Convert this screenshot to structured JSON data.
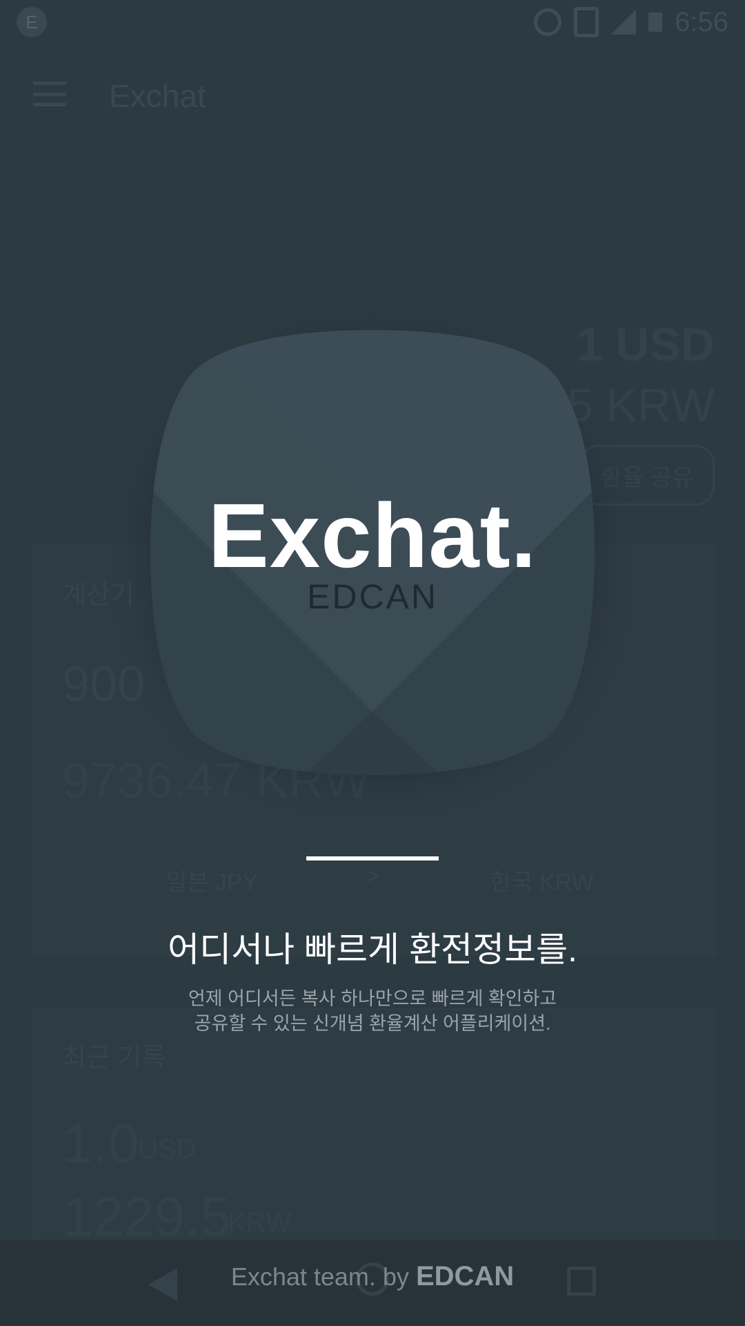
{
  "status_bar": {
    "time": "6:56",
    "left_icon": "E"
  },
  "background_app": {
    "title": "Exchat",
    "rate_from": "1 USD",
    "rate_to": "5 KRW",
    "share_button": "환율 공유",
    "calculator_label": "계산기",
    "input_amount": "900",
    "result": "9736.47 KRW",
    "from_currency": "일본 JPY",
    "arrow": ">",
    "to_currency": "한국 KRW",
    "history_label": "최근 기록",
    "history_value": "1.0",
    "history_unit": "USD",
    "history_value2": "1229.5",
    "history_unit2": "KRW"
  },
  "splash": {
    "logo_text": "Exchat.",
    "logo_sub": "EDCAN",
    "headline": "어디서나 빠르게 환전정보를.",
    "desc_line1": "언제 어디서든 복사 하나만으로 빠르게 확인하고",
    "desc_line2": "공유할 수 있는 신개념 환율계산 어플리케이션.",
    "footer_prefix": "Exchat team. by ",
    "footer_brand": "EDCAN"
  },
  "colors": {
    "background": "#2c3a42",
    "logo": "#3b4c55",
    "text": "#ffffff"
  }
}
